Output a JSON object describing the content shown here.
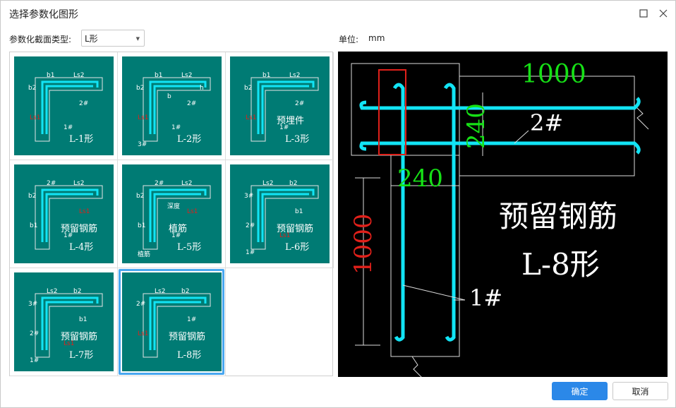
{
  "window": {
    "title": "选择参数化图形"
  },
  "toolbar": {
    "type_label": "参数化截面类型:",
    "type_value": "L形",
    "unit_label": "单位:",
    "unit_value": "mm"
  },
  "shapes": [
    {
      "name": "L-1形",
      "labels": [
        "b1",
        "Ls2",
        "b2",
        "Ls1",
        "2#",
        "1#"
      ]
    },
    {
      "name": "L-2形",
      "labels": [
        "b1",
        "Ls2",
        "b2",
        "Ls1",
        "2#",
        "1#",
        "3#",
        "b",
        "h"
      ]
    },
    {
      "name": "L-3形",
      "title": "预埋件",
      "labels": [
        "b1",
        "Ls2",
        "b2",
        "Ls1",
        "2#",
        "1#"
      ]
    },
    {
      "name": "L-4形",
      "title": "预留钢筋",
      "labels": [
        "2#",
        "Ls2",
        "b2",
        "b1",
        "Ls1",
        "1#"
      ]
    },
    {
      "name": "L-5形",
      "title": "植筋",
      "labels": [
        "2#",
        "Ls2",
        "b2",
        "b1",
        "Ls1",
        "1#",
        "植筋",
        "深度"
      ]
    },
    {
      "name": "L-6形",
      "title": "预留钢筋",
      "labels": [
        "Ls2",
        "b2",
        "3#",
        "2#",
        "b1",
        "Ls1",
        "1#"
      ]
    },
    {
      "name": "L-7形",
      "title": "预留钢筋",
      "labels": [
        "Ls2",
        "b2",
        "3#",
        "2#",
        "b1",
        "Ls1",
        "1#"
      ]
    },
    {
      "name": "L-8形",
      "title": "预留钢筋",
      "labels": [
        "Ls2",
        "b2",
        "2#",
        "Ls1",
        "1#"
      ]
    }
  ],
  "selected_index": 7,
  "preview": {
    "dim_top": "1000",
    "dim_width": "240",
    "dim_height": "240",
    "dim_left": "1000",
    "bar2_label": "2#",
    "bar1_label": "1#",
    "title": "预留钢筋",
    "name": "L-8形"
  },
  "colors": {
    "teal": "#007b74",
    "rebar": "#12e4f5",
    "green": "#16e016",
    "red": "#e0201a",
    "accent": "#2b88e8"
  },
  "buttons": {
    "ok": "确定",
    "cancel": "取消"
  }
}
